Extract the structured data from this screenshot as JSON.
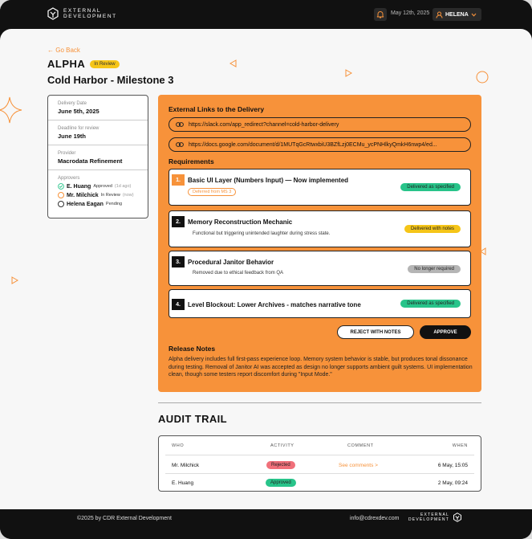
{
  "header": {
    "logo_line1": "EXTERNAL",
    "logo_line2": "DEVELOPMENT",
    "date": "May 12th, 2025",
    "user": "HELENA"
  },
  "nav": {
    "back_label": "← Go Back"
  },
  "project": {
    "name": "ALPHA",
    "status_badge": "In Review",
    "milestone": "Cold Harbor  - Milestone 3"
  },
  "info": {
    "delivery_date_label": "Delivery Date",
    "delivery_date": "June 5th, 2025",
    "deadline_label": "Deadline for review",
    "deadline": "June 19th",
    "provider_label": "Provider",
    "provider": "Macrodata Refinement",
    "approvers_label": "Approvers",
    "approvers": [
      {
        "name": "E. Huang",
        "status": "Approved",
        "ago": "(1d ago)"
      },
      {
        "name": "Mr. Milchick",
        "status": "In Review",
        "ago": "(now)"
      },
      {
        "name": "Helena Eagan",
        "status": "Pending",
        "ago": ""
      }
    ]
  },
  "delivery": {
    "links_title": "External Links to the Delivery",
    "links": [
      "https://slack.com/app_redirect?channel=cold-harbor-delivery",
      "https://docs.google.com/document/d/1MUTqGcRtwxbiU3BZfLzj0ECMu_ycPNHlkyQmkH6nwp4/ed..."
    ],
    "requirements_title": "Requirements",
    "requirements": [
      {
        "num": "1.",
        "title": "Basic UI Layer (Numbers Input) — Now implemented",
        "tag": "Deferred from MS 3",
        "status": "Delivered as specified"
      },
      {
        "num": "2.",
        "title": "Memory Reconstruction Mechanic",
        "desc": "Functional but triggering unintended laughter during stress state.",
        "status": "Delivered with notes"
      },
      {
        "num": "3.",
        "title": "Procedural Janitor Behavior",
        "desc": "Removed due to ethical feedback from QA",
        "status": "No longer required"
      },
      {
        "num": "4.",
        "title": "Level Blockout: Lower Archives - matches narrative tone",
        "status": "Delivered as specified"
      }
    ],
    "reject_label": "REJECT WITH NOTES",
    "approve_label": "APPROVE",
    "notes_title": "Release Notes",
    "notes_text": "Alpha delivery includes full first-pass experience loop. Memory system behavior is stable, but produces tonal dissonance during testing. Removal of Janitor AI was accepted as design no longer supports ambient guilt systems. UI implementation clean, though some testers report discomfort during \"Input Mode.\""
  },
  "audit": {
    "title": "AUDIT TRAIL",
    "headers": {
      "who": "WHO",
      "activity": "ACTIVITY",
      "comment": "COMMENT",
      "when": "WHEN"
    },
    "rows": [
      {
        "who": "Mr. Milchick",
        "activity": "Rejected",
        "comment": "See comments >",
        "when": "6 May, 15:05"
      },
      {
        "who": "E. Huang",
        "activity": "Approved",
        "comment": "",
        "when": "2 May, 09:24"
      }
    ]
  },
  "footer": {
    "copyright": "©2025 by CDR External Development",
    "email": "info@cdrexdev.com",
    "logo_line1": "EXTERNAL",
    "logo_line2": "DEVELOPMENT"
  },
  "colors": {
    "accent": "#f7923a",
    "review": "#f5c518",
    "success": "#28c48a",
    "danger": "#f0707a",
    "muted": "#b5b5b5"
  },
  "icons": [
    "logo-icon",
    "bell-icon",
    "user-icon",
    "chevron-down-icon",
    "link-icon",
    "check-circle-icon"
  ]
}
